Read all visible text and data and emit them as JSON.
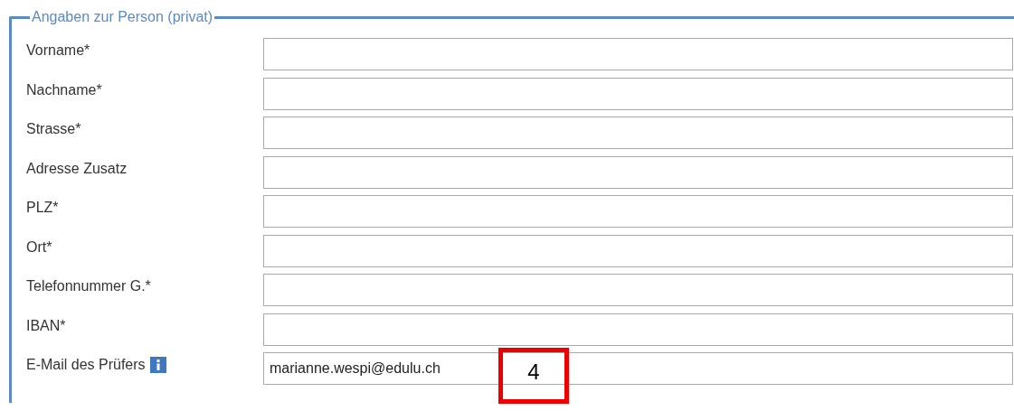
{
  "section": {
    "legend": "Angaben zur Person (privat)",
    "fields": [
      {
        "kind": "plain",
        "label": "Vorname*"
      },
      {
        "kind": "plain",
        "label": "Nachname*"
      },
      {
        "kind": "plain",
        "label": "Strasse*"
      },
      {
        "kind": "plain",
        "label": "Adresse Zusatz"
      },
      {
        "kind": "plain",
        "label": "PLZ*"
      },
      {
        "kind": "plain",
        "label": "Ort*"
      },
      {
        "kind": "plain",
        "label": "Telefonnummer G.*"
      },
      {
        "kind": "plain",
        "label": "IBAN*"
      },
      {
        "kind": "info",
        "label": "E-Mail des Prüfers",
        "value": "marianne.wespi@edulu.ch"
      }
    ]
  },
  "annotation": {
    "number": "4"
  }
}
